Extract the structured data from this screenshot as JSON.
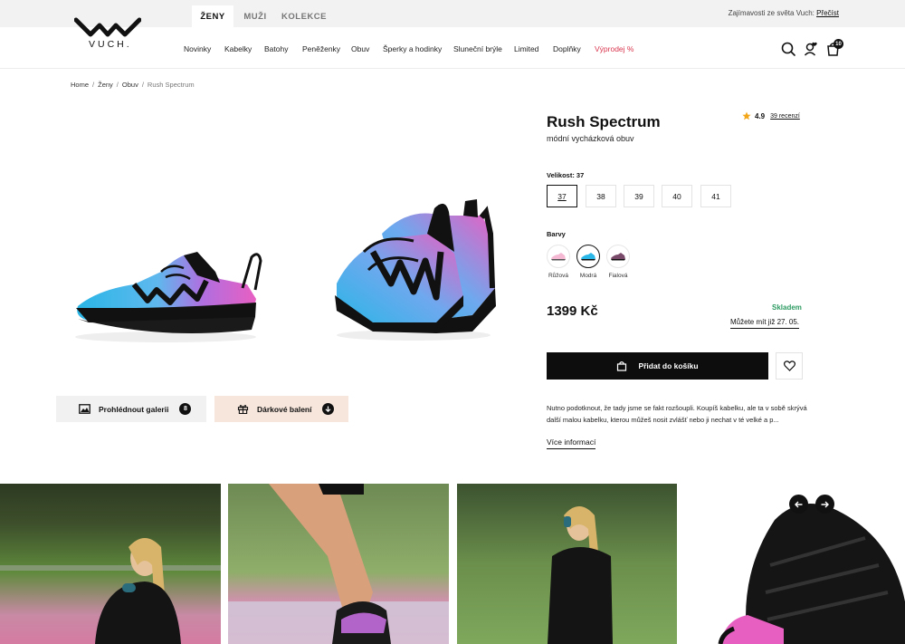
{
  "top_tabs": [
    "ŽENY",
    "MUŽI",
    "KOLEKCE"
  ],
  "top_right": {
    "text": "Zajímavosti ze světa Vuch:",
    "link": "Přečíst"
  },
  "logo": {
    "text": "VUCH."
  },
  "nav": [
    "Novinky",
    "Kabelky",
    "Batohy",
    "Peněženky",
    "Obuv",
    "Šperky a hodinky",
    "Sluneční brýle",
    "Limited",
    "Doplňky",
    "Výprodej %"
  ],
  "cart_count": "10",
  "breadcrumb": [
    "Home",
    "Ženy",
    "Obuv",
    "Rush Spectrum"
  ],
  "gallery": {
    "view_label": "Prohlédnout galerii",
    "view_count": "8",
    "gift_label": "Dárkové balení"
  },
  "product": {
    "title": "Rush Spectrum",
    "subtitle": "módní vycházková obuv",
    "rating": "4.9",
    "reviews": "39 recenzí",
    "size_label": "Velikost: 37",
    "sizes": [
      "37",
      "38",
      "39",
      "40",
      "41"
    ],
    "selected_size": "37",
    "color_label": "Barvy",
    "colors": [
      "Růžová",
      "Modrá",
      "Fialová"
    ],
    "selected_color": "Modrá",
    "price": "1399 Kč",
    "stock": "Skladem",
    "delivery": "Můžete mít již 27. 05.",
    "add_to_cart": "Přidat do košíku",
    "description": "Nutno podotknout, že tady jsme se fakt rozšoupli. Koupíš kabelku, ale ta v sobě skrývá další malou kabelku, kterou můžeš nosit zvlášť nebo ji nechat v té velké a p...",
    "more": "Více informací"
  },
  "colors": {
    "accent_sale": "#d9374f",
    "stock_green": "#2e9b62",
    "gift_bg": "#f7e6dc",
    "gallery_bg": "#f1f1f1",
    "shoe_cyan": "#2ab6e6",
    "shoe_pink": "#e85fc2"
  }
}
